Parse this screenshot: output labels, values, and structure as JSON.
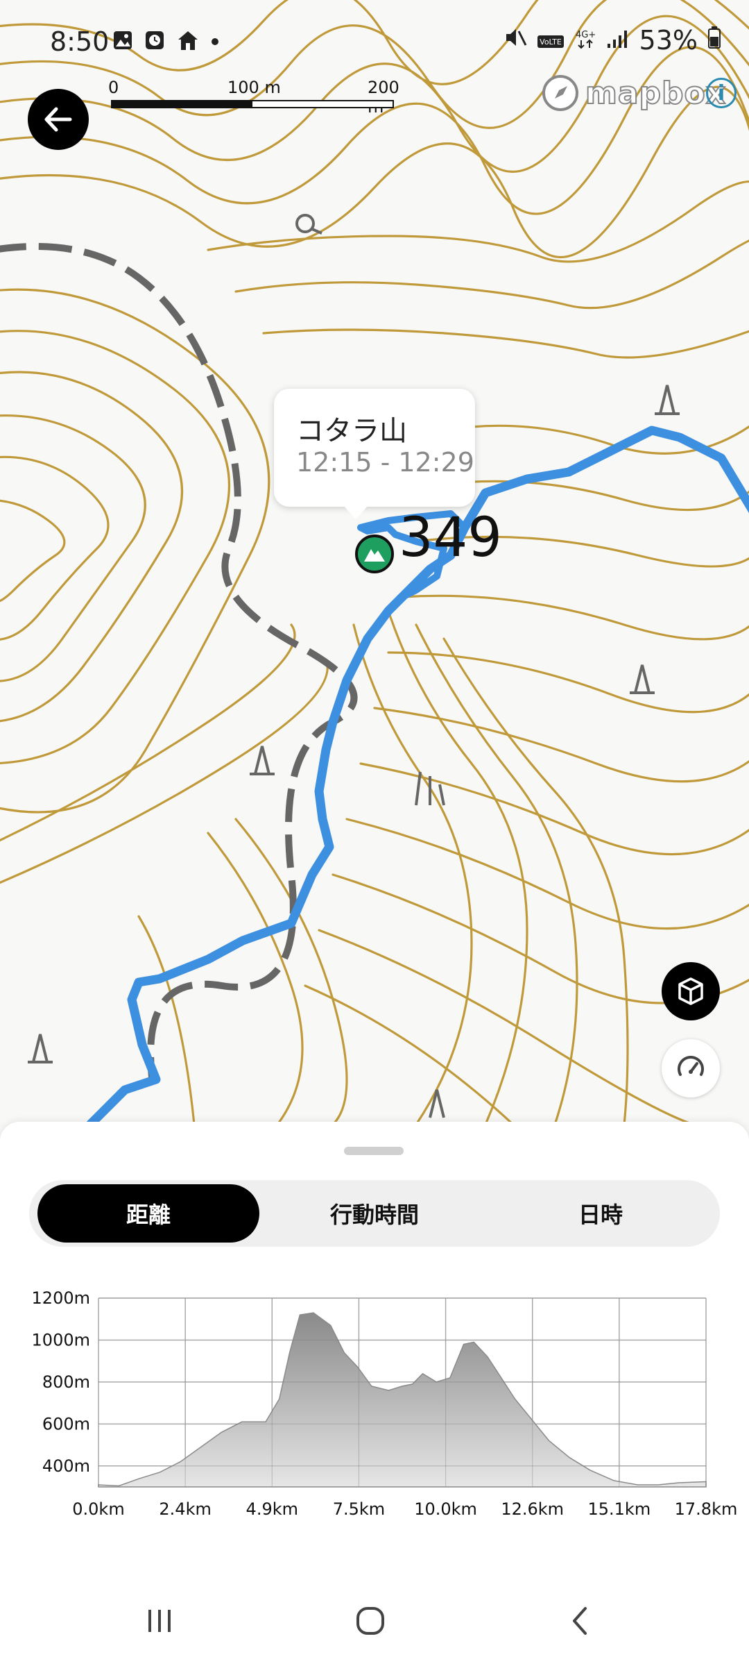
{
  "status_bar": {
    "time": "8:50",
    "battery": "53%",
    "icons_left": [
      "gallery-icon",
      "clock-icon",
      "home-icon",
      "dot-icon"
    ],
    "icons_right": [
      "mute-icon",
      "volte-icon",
      "4g-icon",
      "signal-icon",
      "battery-icon"
    ]
  },
  "map": {
    "scale_labels": [
      "0",
      "100 m",
      "200 m"
    ],
    "attribution": "mapbox",
    "popup": {
      "title": "コタラ山",
      "time_range": "12:15 - 12:29"
    },
    "peak_label": "349",
    "colors": {
      "contour": "#c09a3a",
      "track": "#3d8fe0",
      "trail": "#666666",
      "peak": "#1e9e5f"
    }
  },
  "sheet": {
    "tabs": [
      {
        "label": "距離",
        "active": true
      },
      {
        "label": "行動時間",
        "active": false
      },
      {
        "label": "日時",
        "active": false
      }
    ]
  },
  "chart_data": {
    "type": "area",
    "title": "",
    "xlabel": "",
    "ylabel": "",
    "x_tick_labels": [
      "0.0km",
      "2.4km",
      "4.9km",
      "7.5km",
      "10.0km",
      "12.6km",
      "15.1km",
      "17.8km"
    ],
    "y_tick_labels": [
      "400m",
      "600m",
      "800m",
      "1000m",
      "1200m"
    ],
    "xlim": [
      0,
      17.8
    ],
    "ylim": [
      300,
      1200
    ],
    "grid": true,
    "series": [
      {
        "x": [
          0,
          0.6,
          1.2,
          1.8,
          2.4,
          3.0,
          3.6,
          4.2,
          4.9,
          5.3,
          5.6,
          5.9,
          6.3,
          6.8,
          7.2,
          7.6,
          8.0,
          8.5,
          8.9,
          9.2,
          9.5,
          9.9,
          10.3,
          10.7,
          11.0,
          11.4,
          11.8,
          12.2,
          12.6,
          13.2,
          13.8,
          14.4,
          15.1,
          15.8,
          16.4,
          17.0,
          17.8
        ],
        "y": [
          310,
          305,
          340,
          370,
          420,
          490,
          560,
          610,
          610,
          720,
          940,
          1120,
          1130,
          1070,
          940,
          870,
          780,
          760,
          780,
          790,
          840,
          800,
          820,
          980,
          990,
          920,
          820,
          720,
          640,
          520,
          440,
          380,
          330,
          310,
          310,
          320,
          325
        ]
      }
    ]
  }
}
